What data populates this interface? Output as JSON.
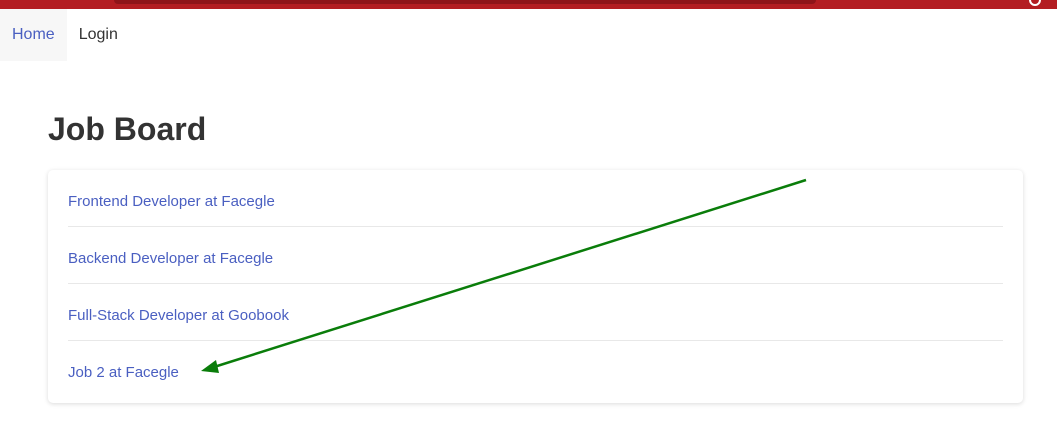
{
  "nav": {
    "items": [
      {
        "label": "Home"
      },
      {
        "label": "Login"
      }
    ]
  },
  "page": {
    "title": "Job Board"
  },
  "jobs": [
    {
      "label": "Frontend Developer at Facegle"
    },
    {
      "label": "Backend Developer at Facegle"
    },
    {
      "label": "Full-Stack Developer at Goobook"
    },
    {
      "label": "Job 2 at Facegle"
    }
  ],
  "colors": {
    "header_bar": "#b31d22",
    "link": "#4a5fc1",
    "annotation_arrow": "#0a7d0a"
  }
}
